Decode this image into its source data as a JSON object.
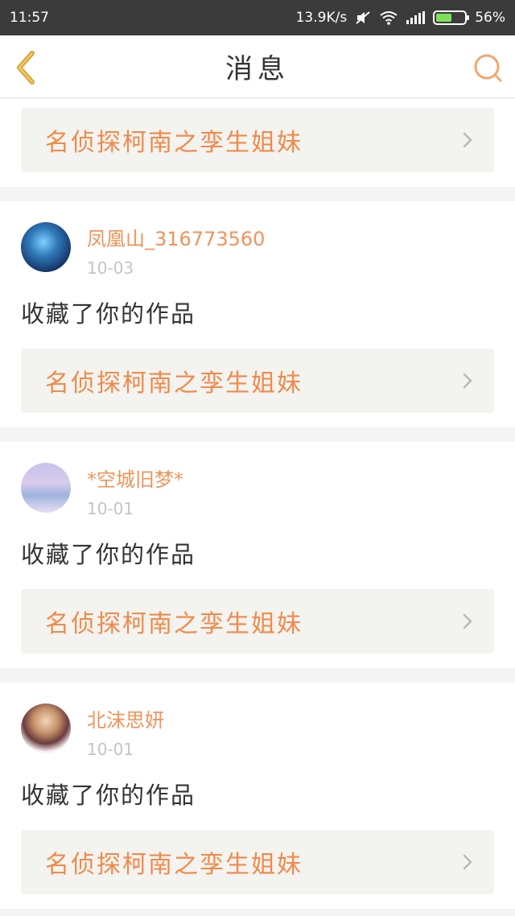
{
  "status_bar": {
    "time": "11:57",
    "net_speed": "13.9K/s",
    "battery_percent": "56%",
    "battery_level": 0.56
  },
  "header": {
    "title": "消息"
  },
  "top_work": {
    "title": "名侦探柯南之孪生姐妹"
  },
  "messages": [
    {
      "username": "凤凰山_316773560",
      "date": "10-03",
      "action": "收藏了你的作品",
      "work_title": "名侦探柯南之孪生姐妹"
    },
    {
      "username": "*空城旧梦*",
      "date": "10-01",
      "action": "收藏了你的作品",
      "work_title": "名侦探柯南之孪生姐妹"
    },
    {
      "username": "北沫思妍",
      "date": "10-01",
      "action": "收藏了你的作品",
      "work_title": "名侦探柯南之孪生姐妹"
    }
  ],
  "colors": {
    "accent": "#f08a4b",
    "back_icon": "#d9a23a",
    "search_icon": "#f5a66e",
    "card_link_bg": "#f3f3ef"
  },
  "icons": {
    "back": "chevron-left-icon",
    "search": "search-icon",
    "row_arrow": "chevron-right-icon"
  }
}
